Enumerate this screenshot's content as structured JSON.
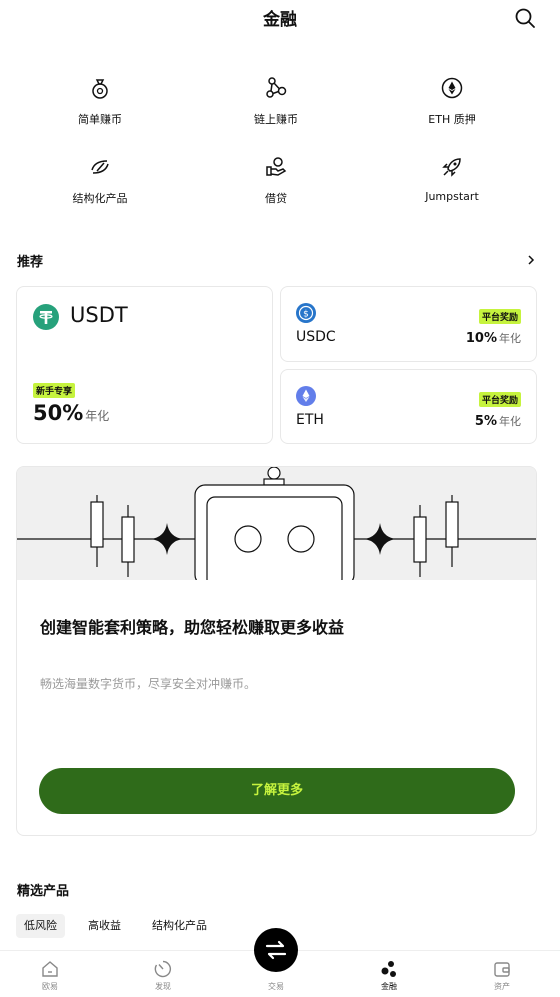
{
  "header": {
    "title": "金融"
  },
  "quick_actions": [
    {
      "label": "简单赚币",
      "icon": "money-bag-icon"
    },
    {
      "label": "链上赚币",
      "icon": "nodes-icon"
    },
    {
      "label": "ETH 质押",
      "icon": "eth-coin-icon"
    },
    {
      "label": "结构化产品",
      "icon": "structured-icon"
    },
    {
      "label": "借贷",
      "icon": "loan-hand-icon"
    },
    {
      "label": "Jumpstart",
      "icon": "rocket-icon"
    }
  ],
  "recommend": {
    "title": "推荐",
    "usdt": {
      "name": "USDT",
      "tag": "新手专享",
      "rate": "50%",
      "unit": "年化"
    },
    "usdc": {
      "name": "USDC",
      "tag": "平台奖励",
      "rate": "10%",
      "unit": "年化"
    },
    "eth": {
      "name": "ETH",
      "tag": "平台奖励",
      "rate": "5%",
      "unit": "年化"
    }
  },
  "banner": {
    "title": "创建智能套利策略，助您轻松赚取更多收益",
    "subtitle": "畅选海量数字货币，尽享安全对冲赚币。",
    "button": "了解更多"
  },
  "featured": {
    "title": "精选产品",
    "chips": [
      "低风险",
      "高收益",
      "结构化产品"
    ]
  },
  "nav": {
    "items": [
      {
        "label": "欧易",
        "icon": "home-icon"
      },
      {
        "label": "发现",
        "icon": "discover-icon"
      },
      {
        "label": "交易",
        "icon": "swap-icon"
      },
      {
        "label": "金融",
        "icon": "finance-icon"
      },
      {
        "label": "资产",
        "icon": "wallet-icon"
      }
    ]
  },
  "colors": {
    "accent_lime": "#c6f33e",
    "button_green": "#2f6b1a",
    "usdt": "#26a17b",
    "usdc": "#2775ca",
    "eth": "#627eea"
  }
}
